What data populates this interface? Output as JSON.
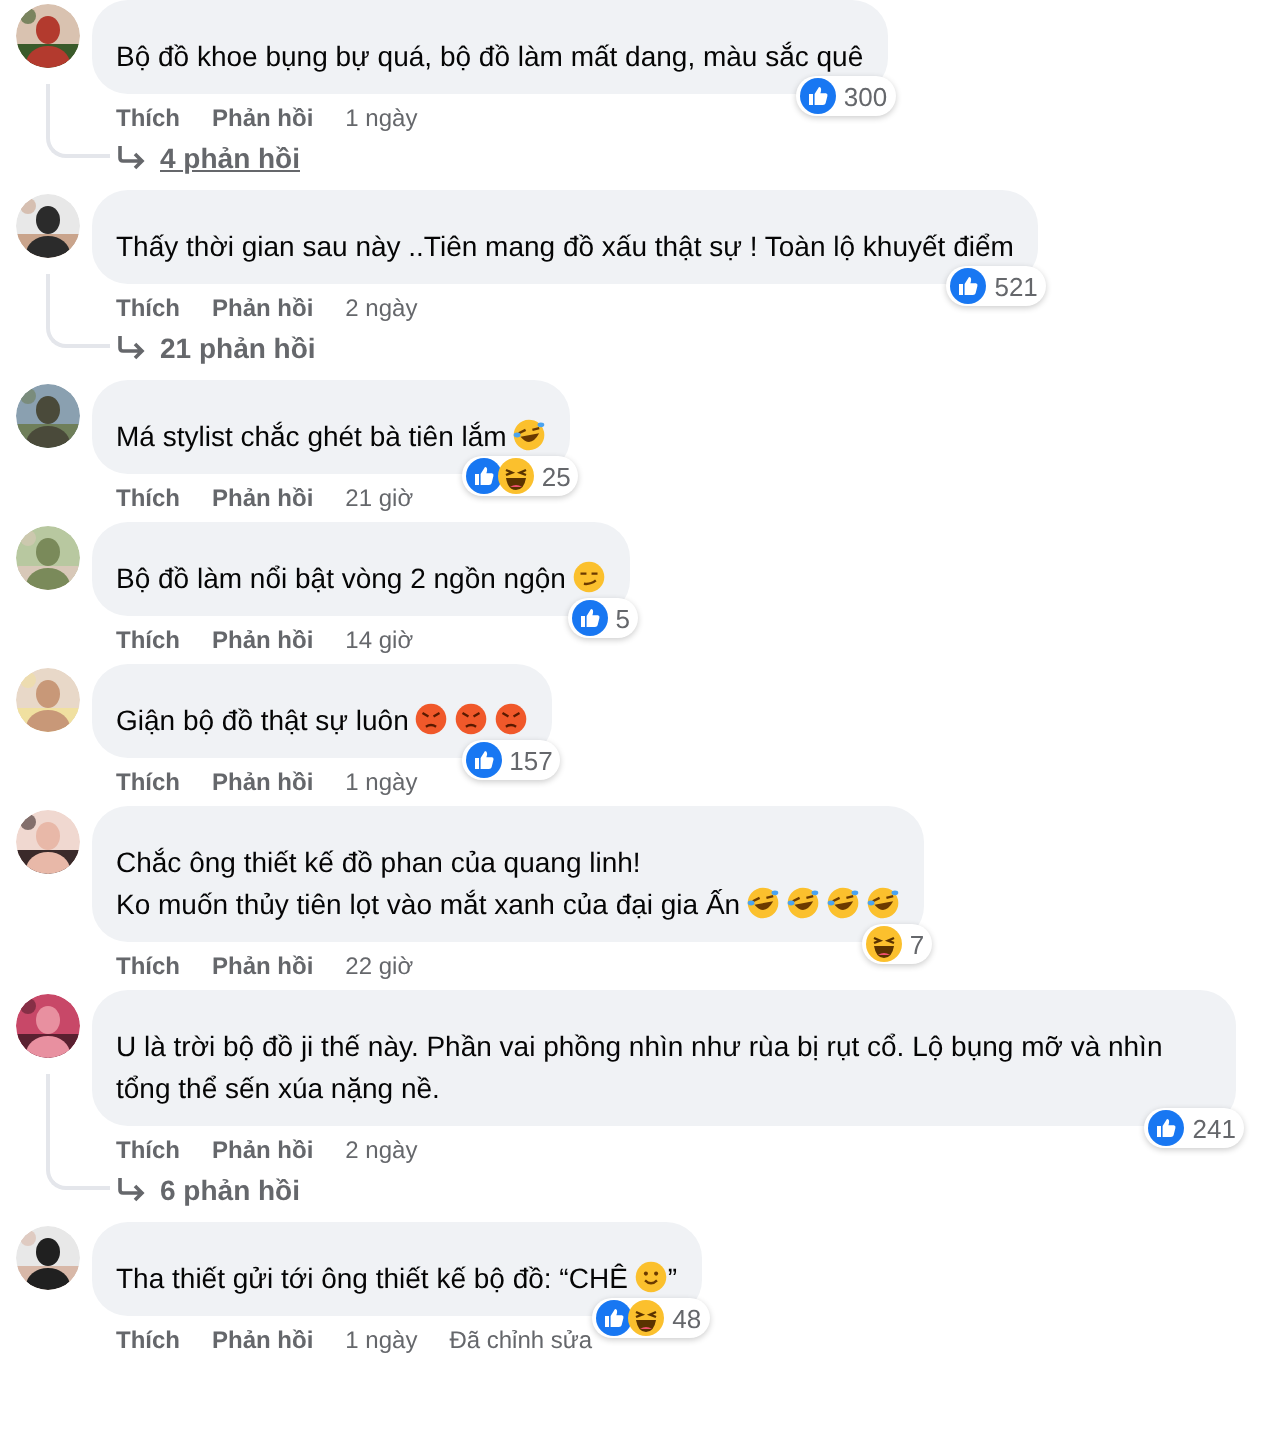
{
  "comments": [
    {
      "parts": [
        {
          "kind": "text",
          "text": "Bộ đồ khoe bụng bự quá, bộ đồ làm mất dang, màu sắc quê"
        }
      ],
      "reactions": [
        {
          "kind": "like"
        }
      ],
      "reaction_count": "300",
      "like": "Thích",
      "reply": "Phản hồi",
      "time": "1 ngày",
      "replies": {
        "text": "4 phản hồi",
        "hovered": true
      }
    },
    {
      "parts": [
        {
          "kind": "text",
          "text": "Thấy thời gian sau này ..Tiên mang đồ xấu thật sự ! Toàn lộ khuyết điểm"
        }
      ],
      "reactions": [
        {
          "kind": "like"
        }
      ],
      "reaction_count": "521",
      "like": "Thích",
      "reply": "Phản hồi",
      "time": "2 ngày",
      "replies": {
        "text": "21 phản hồi",
        "hovered": false
      }
    },
    {
      "parts": [
        {
          "kind": "text",
          "text": "Má stylist chắc ghét bà tiên lắm"
        },
        {
          "kind": "rofl"
        }
      ],
      "reactions": [
        {
          "kind": "like"
        },
        {
          "kind": "haha"
        }
      ],
      "reaction_count": "25",
      "like": "Thích",
      "reply": "Phản hồi",
      "time": "21 giờ"
    },
    {
      "parts": [
        {
          "kind": "text",
          "text": "Bộ đồ làm nổi bật vòng 2 ngồn ngộn"
        },
        {
          "kind": "smirk"
        }
      ],
      "reactions": [
        {
          "kind": "like"
        }
      ],
      "reaction_count": "5",
      "like": "Thích",
      "reply": "Phản hồi",
      "time": "14 giờ"
    },
    {
      "parts": [
        {
          "kind": "text",
          "text": "Giận bộ đồ thật sự luôn"
        },
        {
          "kind": "angry"
        },
        {
          "kind": "angry"
        },
        {
          "kind": "angry"
        }
      ],
      "reactions": [
        {
          "kind": "like"
        }
      ],
      "reaction_count": "157",
      "like": "Thích",
      "reply": "Phản hồi",
      "time": "1 ngày"
    },
    {
      "parts": [
        {
          "kind": "text",
          "text": "Chắc ông thiết kế đồ phan của quang linh!"
        },
        {
          "kind": "break"
        },
        {
          "kind": "text",
          "text": "Ko muốn thủy tiên lọt vào mắt xanh của đại gia Ấn"
        },
        {
          "kind": "rofl"
        },
        {
          "kind": "rofl"
        },
        {
          "kind": "rofl"
        },
        {
          "kind": "rofl"
        }
      ],
      "reactions": [
        {
          "kind": "haha"
        }
      ],
      "reaction_count": "7",
      "like": "Thích",
      "reply": "Phản hồi",
      "time": "22 giờ"
    },
    {
      "parts": [
        {
          "kind": "text",
          "text": "U là trời bộ đồ ji thế này. Phần vai phồng nhìn như rùa bị rụt cổ. Lộ bụng mỡ và nhìn tổng thể sến xúa nặng nề."
        }
      ],
      "reactions": [
        {
          "kind": "like"
        }
      ],
      "reaction_count": "241",
      "like": "Thích",
      "reply": "Phản hồi",
      "time": "2 ngày",
      "replies": {
        "text": "6 phản hồi",
        "hovered": false
      }
    },
    {
      "parts": [
        {
          "kind": "text",
          "text": "Tha thiết gửi tới ông thiết kế bộ đồ: “CHÊ"
        },
        {
          "kind": "smile"
        },
        {
          "kind": "text",
          "text": "”"
        }
      ],
      "reactions": [
        {
          "kind": "like"
        },
        {
          "kind": "haha"
        }
      ],
      "reaction_count": "48",
      "like": "Thích",
      "reply": "Phản hồi",
      "time": "1 ngày",
      "edited": "Đã chỉnh sửa"
    }
  ]
}
